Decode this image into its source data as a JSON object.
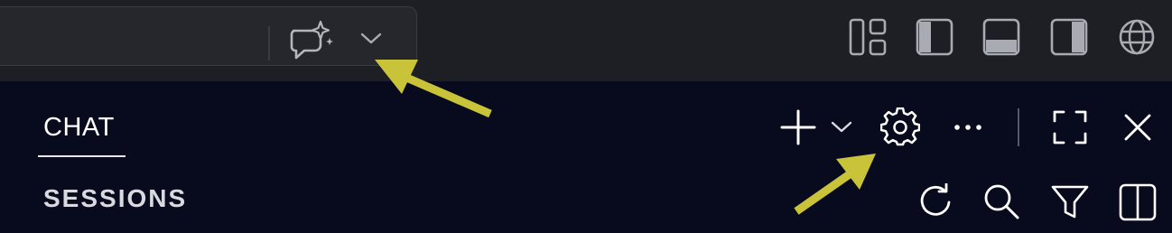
{
  "titlebar": {
    "command_center": {
      "chat_icon": "chat-sparkle-icon",
      "dropdown_icon": "chevron-down-icon"
    },
    "layout_buttons": [
      {
        "name": "customize-layout-icon"
      },
      {
        "name": "toggle-primary-sidebar-icon"
      },
      {
        "name": "toggle-panel-icon"
      },
      {
        "name": "toggle-secondary-sidebar-icon"
      },
      {
        "name": "globe-icon"
      }
    ]
  },
  "chat_panel": {
    "tab_label": "CHAT",
    "sessions_label": "SESSIONS",
    "toolbar_icons": [
      "plus-icon",
      "chevron-down-icon",
      "gear-icon",
      "more-icon",
      "maximize-icon",
      "close-icon"
    ],
    "sessions_icons": [
      "refresh-icon",
      "search-icon",
      "filter-icon",
      "split-icon"
    ]
  },
  "colors": {
    "titlebar_bg": "#1e1f25",
    "panel_bg": "#080a1e",
    "icon": "#a9abb3",
    "annotation_arrow": "#c9c33a"
  }
}
